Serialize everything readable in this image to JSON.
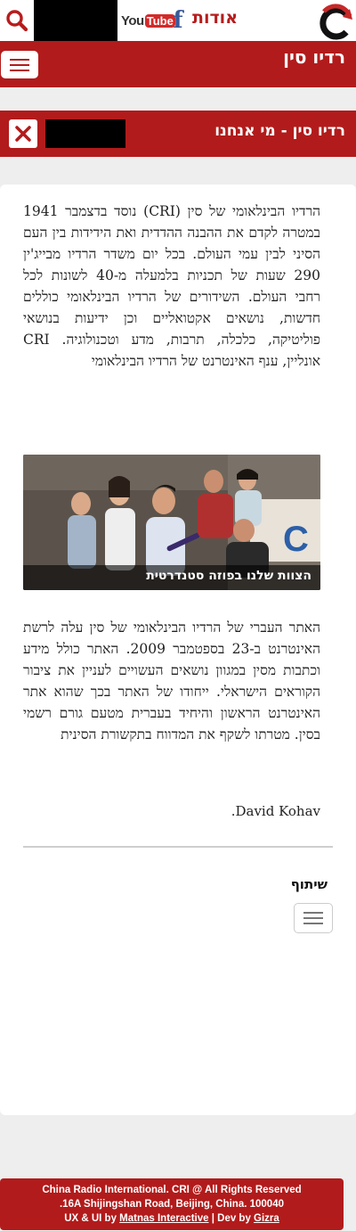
{
  "header": {
    "youtube_you": "You",
    "youtube_tube": "Tube",
    "facebook_letter": "f",
    "about_label": "אודות"
  },
  "brand": {
    "title": "רדיו סין"
  },
  "page": {
    "title": "רדיו סין - מי אנחנו"
  },
  "content": {
    "paragraph1": "הרדיו הבינלאומי של סין (CRI) נוסד בדצמבר 1941 במטרה לקדם את ההבנה ההדדית ואת הידידות בין העם הסיני לבין עמי העולם. בכל יום משדר הרדיו מבייג'ין 290 שעות של תכניות בלמעלה מ-40 לשונות לכל רחבי העולם. השידורים של הרדיו הבינלאומי כוללים חדשות, נושאים אקטואליים וכן ידיעות בנושאי פוליטיקה, כלכלה, תרבות, מדע וטכנולוגיה. CRI אונליין, ענף האינטרנט של הרדיו הבינלאומי",
    "photo_caption": "הצוות שלנו בפוזה סטנדרטית",
    "paragraph2": "האתר העברי של הרדיו הבינלאומי של סין עלה לרשת האינטרנט ב-23 בספטמבר 2009. האתר כולל מידע וכתבות מסין במגוון נושאים העשויים לעניין את ציבור הקוראים הישראלי. ייחודו של האתר בכך שהוא אתר האינטרנט הראשון והיחיד בעברית מטעם גורם רשמי בסין. מטרתו לשקף את המדווח בתקשורת הסינית",
    "signature": "David Kohav."
  },
  "share": {
    "label": "שיתוף"
  },
  "footer": {
    "line1": "China Radio International. CRI @ All Rights Reserved",
    "line2": ".16A Shijingshan Road, Beijing, China. 100040",
    "line3_prefix": "UX & UI by ",
    "line3_link1": "Matnas Interactive",
    "line3_sep": " | Dev by ",
    "line3_link2": "Gizra"
  },
  "colors": {
    "brand_red": "#b21b1b",
    "background": "#eeeeee",
    "facebook_blue": "#3b5998"
  },
  "icons": {
    "search": "search-icon",
    "menu": "hamburger-menu-icon",
    "close": "close-icon",
    "logo": "cri-logo-icon"
  }
}
